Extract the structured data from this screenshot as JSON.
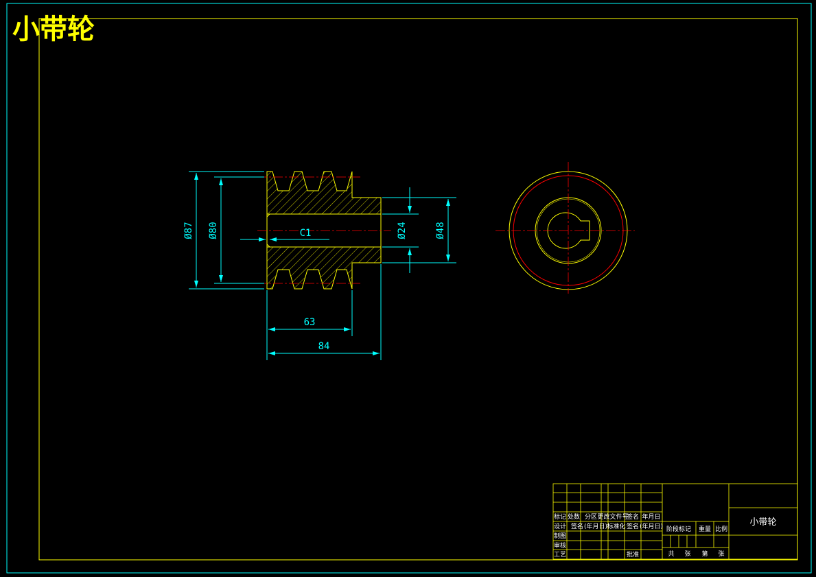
{
  "drawing": {
    "title": "小带轮",
    "colors": {
      "frame": "#ffff00",
      "outer_border": "#00ffff",
      "part": "#ffff00",
      "hatch": "#ffff00",
      "center_line": "#ff0000",
      "dimension": "#00ffff",
      "title_block": "#ffff00",
      "text": "#ffffff"
    }
  },
  "dimensions": {
    "d87": "Ø87",
    "d80": "Ø80",
    "chamfer": "C1",
    "d24": "Ø24",
    "d48": "Ø48",
    "l63": "63",
    "l84": "84"
  },
  "title_block": {
    "row_labels_1": [
      "标记",
      "处数",
      "分区",
      "更改文件号",
      "签名",
      "年月日"
    ],
    "row_labels_2": [
      "设计",
      "签名",
      "(年月日)",
      "标准化",
      "签名",
      "(年月日)"
    ],
    "left_labels": [
      "制图",
      "审核",
      "工艺"
    ],
    "approve": "批准",
    "stage": "阶段标记",
    "weight": "重量",
    "scale": "比例",
    "sheets": [
      "共",
      "张",
      "第",
      "张"
    ],
    "part_name": "小带轮"
  }
}
